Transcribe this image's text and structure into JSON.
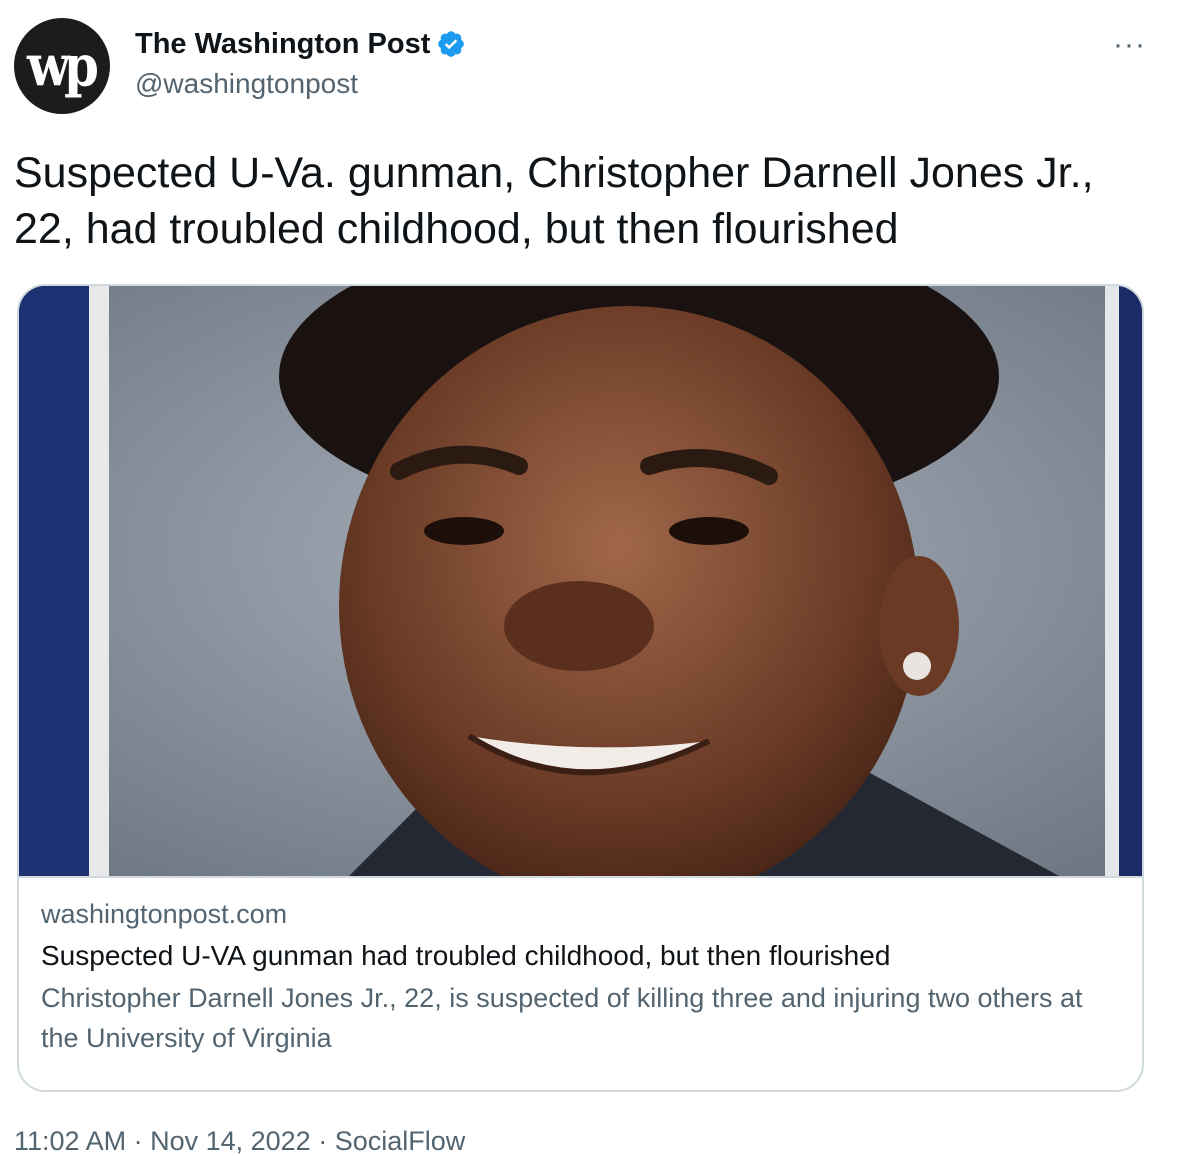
{
  "account": {
    "display_name": "The Washington Post",
    "handle": "@washingtonpost",
    "avatar_logo": "wp",
    "verified_icon": "verified-badge-icon",
    "verified_color": "#1d9bf0"
  },
  "more_label": "···",
  "tweet": {
    "text": "Suspected U-Va. gunman, Christopher Darnell Jones Jr., 22, had troubled childhood, but then flourished"
  },
  "card": {
    "image_icon": "portrait-photo",
    "domain": "washingtonpost.com",
    "title": "Suspected U-VA gunman had troubled childhood, but then flourished",
    "description": "Christopher Darnell Jones Jr., 22, is suspected of killing three and injuring two others at the University of Virginia"
  },
  "meta": {
    "time": "11:02 AM",
    "sep1": " · ",
    "date": "Nov 14, 2022",
    "sep2": " · ",
    "source": "SocialFlow"
  },
  "colors": {
    "text_primary": "#0f1419",
    "text_secondary": "#536471",
    "border": "#cfd9de",
    "verified": "#1d9bf0"
  }
}
